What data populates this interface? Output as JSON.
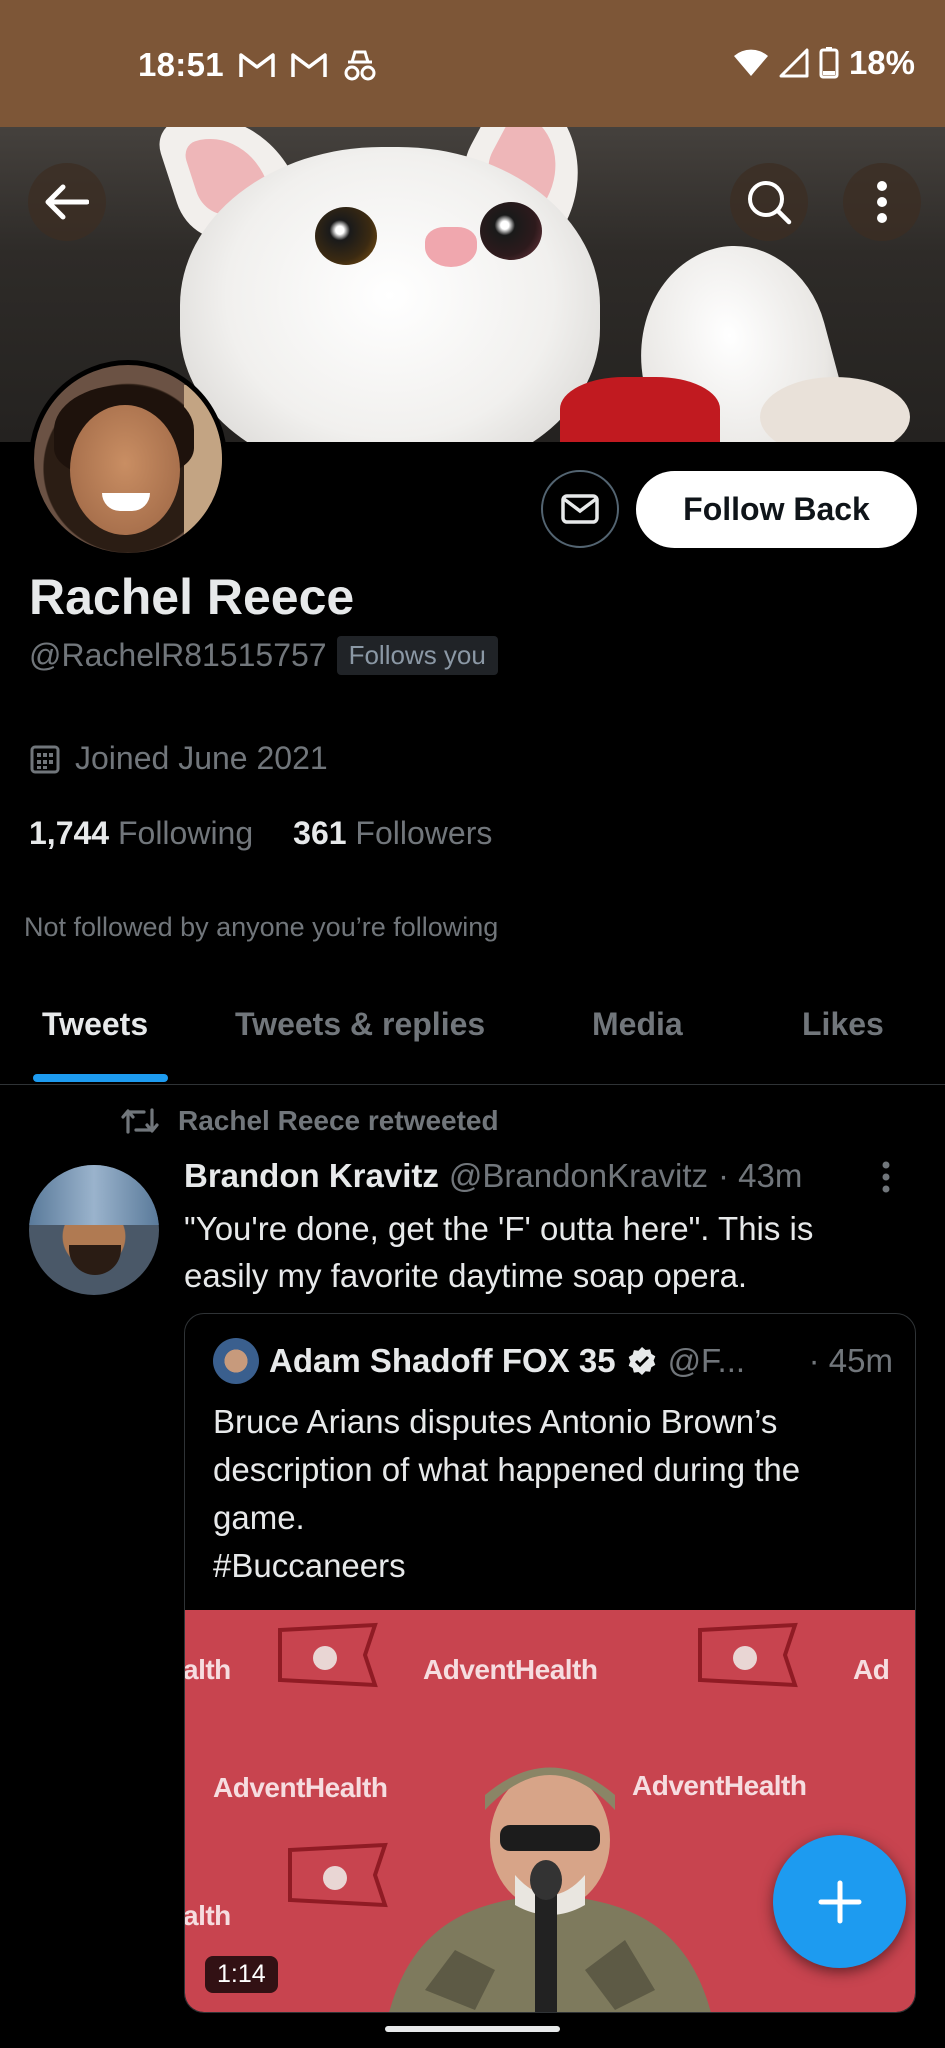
{
  "status_bar": {
    "time": "18:51",
    "left_icons": [
      "gmail-icon",
      "gmail-icon",
      "incognito-icon"
    ],
    "battery": "18%",
    "right_icons": [
      "wifi-icon",
      "signal-icon",
      "battery-icon"
    ]
  },
  "header": {
    "back_icon": "arrow-left-icon",
    "search_icon": "search-icon",
    "more_icon": "more-vertical-icon"
  },
  "profile": {
    "name": "Rachel Reece",
    "handle": "@RachelR81515757",
    "follows_you": "Follows you",
    "joined": "Joined June 2021",
    "following_count": "1,744",
    "following_label": "Following",
    "followers_count": "361",
    "followers_label": "Followers",
    "not_followed": "Not followed by anyone you’re following",
    "follow_button": "Follow Back",
    "message_icon": "envelope-icon"
  },
  "tabs": [
    {
      "label": "Tweets",
      "active": true
    },
    {
      "label": "Tweets & replies",
      "active": false
    },
    {
      "label": "Media",
      "active": false
    },
    {
      "label": "Likes",
      "active": false
    }
  ],
  "tweet": {
    "retweeted_by": "Rachel Reece retweeted",
    "author_name": "Brandon Kravitz",
    "author_handle": "@BrandonKravitz",
    "time": "· 43m",
    "text": "\"You're done, get the 'F' outta here\". This is easily my favorite daytime soap opera.",
    "quote": {
      "author_name": "Adam Shadoff FOX 35",
      "author_handle": "@F...",
      "time": "· 45m",
      "text_lines": [
        "Bruce Arians disputes Antonio Brown’s description of what happened during the game.",
        "#Buccaneers"
      ],
      "media_sponsor": "AdventHealth",
      "media_sponsor_fragment": "alth",
      "media_sponsor_fragment_right": "Ad",
      "duration": "1:14"
    }
  },
  "colors": {
    "accent": "#1d9bf0",
    "status_bar": "#7d5637",
    "muted_text": "#71767b"
  }
}
